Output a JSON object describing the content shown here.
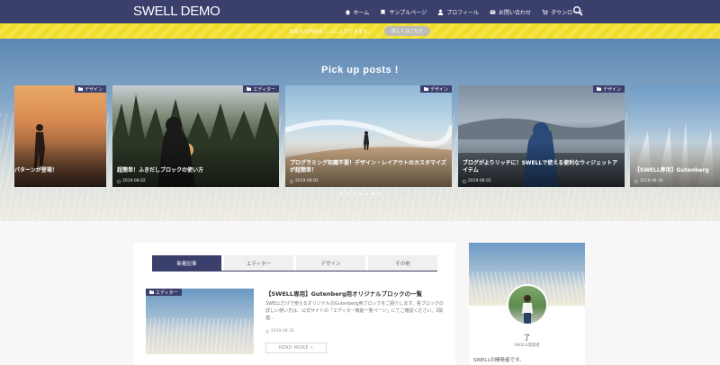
{
  "header": {
    "logo": "SWELL DEMO",
    "nav": [
      {
        "label": "ホーム",
        "icon": "home-icon"
      },
      {
        "label": "サンプルページ",
        "icon": "bookmark-icon"
      },
      {
        "label": "プロフィール",
        "icon": "user-icon"
      },
      {
        "label": "お問い合わせ",
        "icon": "mail-icon"
      },
      {
        "label": "ダウンロード",
        "icon": "cart-icon"
      }
    ],
    "search_icon": "search-icon"
  },
  "notice": {
    "text": "お知らせ内容をここに入力できます。",
    "button": "詳しくはこちら"
  },
  "hero": {
    "heading": "Pick up posts !",
    "cards": [
      {
        "tag": "デザイン",
        "title": "パターンが登場！",
        "date": ""
      },
      {
        "tag": "エディター",
        "title": "超簡単！ふきだしブロックの使い方",
        "date": "2019.08.02"
      },
      {
        "tag": "デザイン",
        "title": "プログラミング知識不要！デザイン・レイアウトのカスタマイズが超簡単！",
        "date": "2019.08.02"
      },
      {
        "tag": "デザイン",
        "title": "ブログがよりリッチに！SWELLで使える便利なウィジェットアイテム",
        "date": "2019.08.02"
      },
      {
        "tag": "",
        "title": "【SWELL専用】Gutenberg",
        "date": "2019.08.30"
      }
    ],
    "dot_count": 7,
    "active_dot": 5
  },
  "main": {
    "tabs": [
      "新着記事",
      "エディター",
      "デザイン",
      "その他"
    ],
    "post": {
      "tag": "エディター",
      "title": "【SWELL専用】Gutenberg用オリジナルブロックの一覧",
      "excerpt": "SWELLだけで使えるオリジナルのGutenberg用ブロックをご紹介します。各ブロックの詳しい使い方は、公式サイトの「エディター機能一覧ページ」にてご確認ください。【関連...",
      "date": "2019.08.30",
      "readmore": "READ MORE »"
    }
  },
  "sidebar": {
    "name": "了",
    "role": "SWELL開発者",
    "description": "SWELLの開発者です。"
  },
  "colors": {
    "brand": "#3a3f6b",
    "notice": "#f0dc2a"
  }
}
